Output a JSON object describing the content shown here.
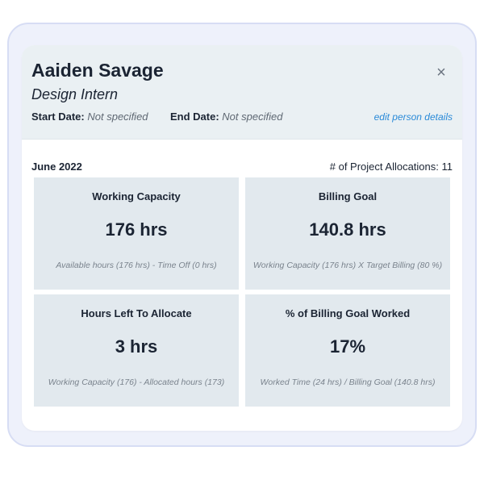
{
  "person": {
    "name": "Aaiden Savage",
    "role": "Design Intern",
    "start_date_label": "Start Date:",
    "start_date_value": "Not specified",
    "end_date_label": "End Date:",
    "end_date_value": "Not specified",
    "edit_link": "edit person details",
    "close_icon": "×"
  },
  "summary": {
    "month": "June 2022",
    "allocations_label": "# of Project Allocations: 11"
  },
  "tiles": [
    {
      "title": "Working Capacity",
      "value": "176 hrs",
      "formula": "Available hours (176 hrs) - Time Off (0 hrs)"
    },
    {
      "title": "Billing Goal",
      "value": "140.8 hrs",
      "formula": "Working Capacity (176 hrs) X Target Billing (80 %)"
    },
    {
      "title": "Hours Left To Allocate",
      "value": "3 hrs",
      "formula": "Working Capacity (176) - Allocated hours (173)"
    },
    {
      "title": "% of Billing Goal Worked",
      "value": "17%",
      "formula": "Worked Time (24 hrs) / Billing Goal (140.8 hrs)"
    }
  ],
  "colors": {
    "header_bg": "#eaf0f3",
    "tile_bg": "#e2e9ee",
    "text": "#1b2433",
    "link": "#2a8ad8"
  }
}
